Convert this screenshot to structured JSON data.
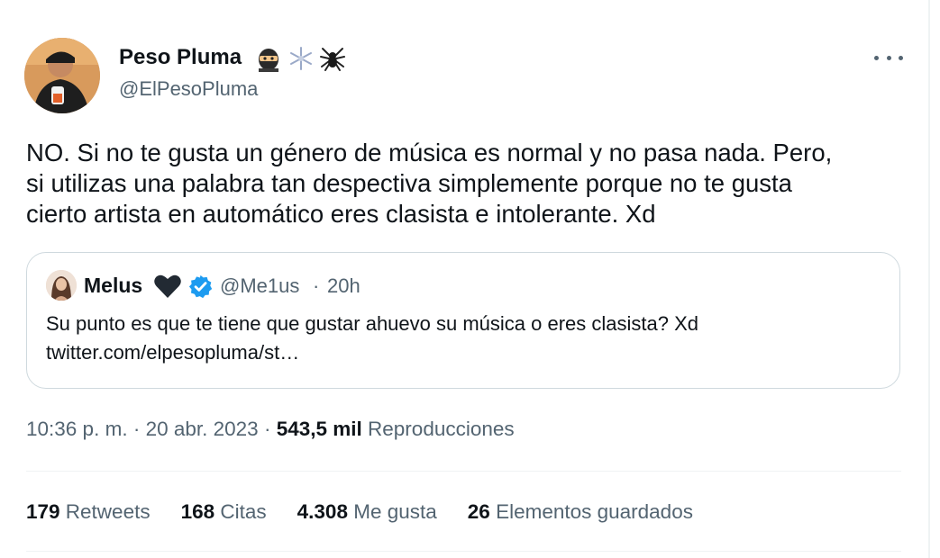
{
  "tweet": {
    "author_name": "Peso Pluma",
    "author_emojis": [
      "ninja-icon",
      "snowflake-icon",
      "spider-icon"
    ],
    "author_handle": "@ElPesoPluma",
    "text_lines": [
      "NO. Si no te gusta un género de música es normal y no pasa nada. Pero,",
      "si utilizas una palabra tan despectiva simplemente porque no te gusta",
      "cierto artista en automático eres clasista e intolerante. Xd"
    ],
    "quote": {
      "name": "Melus",
      "handle": "@Me1us",
      "separator": "·",
      "time": "20h",
      "text_lines": [
        "Su punto es que te tiene que gustar ahuevo su música o eres clasista? Xd",
        "twitter.com/elpesopluma/st…"
      ]
    },
    "meta": {
      "time": "10:36 p. m.",
      "sep1": " · ",
      "date": "20 abr. 2023",
      "sep2": " · ",
      "views": "543,5 mil",
      "views_label": " Reproducciones"
    },
    "stats": [
      {
        "num": "179",
        "label": " Retweets"
      },
      {
        "num": "168",
        "label": " Citas"
      },
      {
        "num": "4.308",
        "label": " Me gusta"
      },
      {
        "num": "26",
        "label": " Elementos guardados"
      }
    ]
  },
  "colors": {
    "text": "#0f1419",
    "secondary": "#536471",
    "border": "#cfd9de",
    "divider": "#eff3f4",
    "verified": "#1d9bf0"
  }
}
